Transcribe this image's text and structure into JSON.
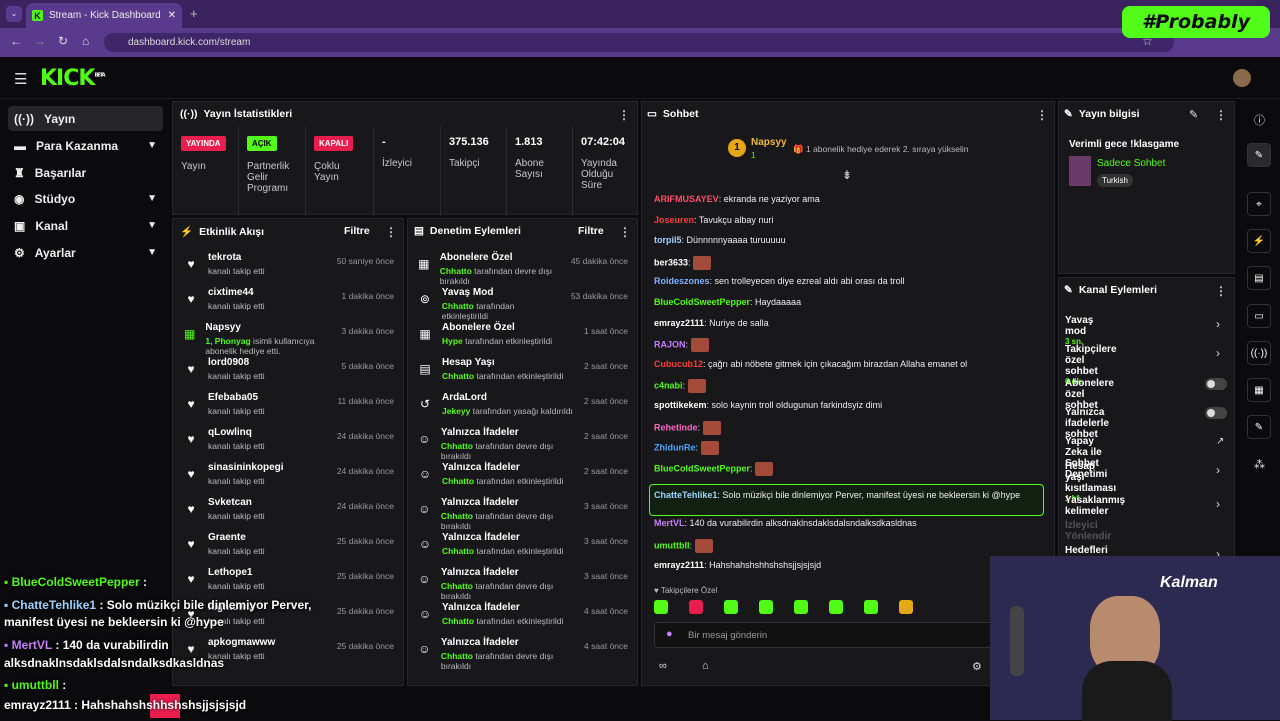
{
  "browser": {
    "tab_title": "Stream - Kick Dashboard",
    "url": "dashboard.kick.com/stream",
    "overlay_text": "#Probably"
  },
  "kick": {
    "logo": "KICK",
    "logo_sup": "BETA"
  },
  "sidebar": {
    "items": [
      {
        "label": "Yayın",
        "icon": "broadcast-icon"
      },
      {
        "label": "Para Kazanma",
        "icon": "money-icon"
      },
      {
        "label": "Başarılar",
        "icon": "trophy-icon"
      },
      {
        "label": "Stüdyo",
        "icon": "studio-icon"
      },
      {
        "label": "Kanal",
        "icon": "channel-icon"
      },
      {
        "label": "Ayarlar",
        "icon": "gear-icon"
      }
    ]
  },
  "stats": {
    "title": "Yayın İstatistikleri",
    "cells": [
      {
        "badge": "YAYINDA",
        "label": "Yayın"
      },
      {
        "badge": "AÇIK",
        "label": "Partnerlik Gelir Programı"
      },
      {
        "badge": "KAPALI",
        "label": "Çoklu Yayın"
      },
      {
        "value": "-",
        "label": "İzleyici"
      },
      {
        "value": "375.136",
        "label": "Takipçi"
      },
      {
        "value": "1.813",
        "label": "Abone Sayısı"
      },
      {
        "value": "07:42:04",
        "label": "Yayında Olduğu Süre"
      }
    ]
  },
  "activity": {
    "title": "Etkinlik Akışı",
    "filter": "Filtre",
    "items": [
      {
        "name": "tekrota",
        "sub": "kanalı takip etti",
        "time": "50 saniye önce"
      },
      {
        "name": "cixtime44",
        "sub": "kanalı takip etti",
        "time": "1 dakika önce"
      },
      {
        "name": "Napsyy",
        "sub_b": "1, Phonyag",
        "sub": " isimli kullanıcıya abonelik hediye etti.",
        "time": "3 dakika önce"
      },
      {
        "name": "lord0908",
        "sub": "kanalı takip etti",
        "time": "5 dakika önce"
      },
      {
        "name": "Efebaba05",
        "sub": "kanalı takip etti",
        "time": "11 dakika önce"
      },
      {
        "name": "qLowlinq",
        "sub": "kanalı takip etti",
        "time": "24 dakika önce"
      },
      {
        "name": "sinasininkopegi",
        "sub": "kanalı takip etti",
        "time": "24 dakika önce"
      },
      {
        "name": "Svketcan",
        "sub": "kanalı takip etti",
        "time": "24 dakika önce"
      },
      {
        "name": "Graente",
        "sub": "kanalı takip etti",
        "time": "25 dakika önce"
      },
      {
        "name": "Lethope1",
        "sub": "kanalı takip etti",
        "time": "25 dakika önce"
      },
      {
        "name": "nightowiz",
        "sub": "kanalı takip etti",
        "time": "25 dakika önce"
      },
      {
        "name": "apkogmawww",
        "sub": "kanalı takip etti",
        "time": "25 dakika önce"
      }
    ]
  },
  "moderation": {
    "title": "Denetim Eylemleri",
    "filter": "Filtre",
    "items": [
      {
        "name": "Abonelere Özel",
        "who": "Chhatto",
        "sub": " tarafından devre dışı bırakıldı",
        "time": "45 dakika önce"
      },
      {
        "name": "Yavaş Mod",
        "who": "Chhatto",
        "sub": " tarafından etkinleştirildi",
        "time": "53 dakika önce"
      },
      {
        "name": "Abonelere Özel",
        "who": "Hype",
        "sub": " tarafından etkinleştirildi",
        "time": "1 saat önce"
      },
      {
        "name": "Hesap Yaşı",
        "who": "Chhatto",
        "sub": " tarafından etkinleştirildi",
        "time": "2 saat önce"
      },
      {
        "name": "ArdaLord",
        "who": "Jekeyy",
        "sub": " tarafından yasağı kaldırıldı",
        "time": "2 saat önce"
      },
      {
        "name": "Yalnızca İfadeler",
        "who": "Chhatto",
        "sub": " tarafından devre dışı bırakıldı",
        "time": "2 saat önce"
      },
      {
        "name": "Yalnızca İfadeler",
        "who": "Chhatto",
        "sub": " tarafından etkinleştirildi",
        "time": "2 saat önce"
      },
      {
        "name": "Yalnızca İfadeler",
        "who": "Chhatto",
        "sub": " tarafından devre dışı bırakıldı",
        "time": "3 saat önce"
      },
      {
        "name": "Yalnızca İfadeler",
        "who": "Chhatto",
        "sub": " tarafından etkinleştirildi",
        "time": "3 saat önce"
      },
      {
        "name": "Yalnızca İfadeler",
        "who": "Chhatto",
        "sub": " tarafından devre dışı bırakıldı",
        "time": "3 saat önce"
      },
      {
        "name": "Yalnızca İfadeler",
        "who": "Chhatto",
        "sub": " tarafından etkinleştirildi",
        "time": "4 saat önce"
      },
      {
        "name": "Yalnızca İfadeler",
        "who": "Chhatto",
        "sub": " tarafından devre dışı bırakıldı",
        "time": "4 saat önce"
      }
    ]
  },
  "chat": {
    "title": "Sohbet",
    "pinned_user": "Napsyy",
    "pinned_count": "1",
    "pinned_rank": "1",
    "pinned_text": "1 abonelik hediye ederek 2. sıraya yükselin",
    "messages": [
      {
        "user": "ARIFMUSAYEV",
        "color": "#ff4d6d",
        "text": ": ekranda ne yaziyor ama"
      },
      {
        "user": "Joseuren",
        "color": "#ff3b3b",
        "text": ": Tavukçu albay nuri"
      },
      {
        "user": "torpil5",
        "color": "#9fd3ff",
        "text": ": Dünnnnnyaaaa turuuuuu"
      },
      {
        "user": "ber3633",
        "color": "#ffffff",
        "text": ":",
        "emote": true
      },
      {
        "user": "Roideszones",
        "color": "#7fb3ff",
        "text": ": sen trolleyecen diye ezreal aldı abi orası da troll"
      },
      {
        "user": "BlueColdSweetPepper",
        "color": "#53fc18",
        "text": ": Haydaaaaa"
      },
      {
        "user": "emrayz2111",
        "color": "#ffffff",
        "text": ": Nuriye de salla"
      },
      {
        "user": "RAJON",
        "color": "#c77dff",
        "text": ":",
        "emote": true
      },
      {
        "user": "Cubucub12",
        "color": "#ff3b3b",
        "text": ": çağrı abi nöbete gitmek için çıkacağım birazdan Allaha emanet ol"
      },
      {
        "user": "c4nabi",
        "color": "#53fc18",
        "text": ":",
        "emote": true
      },
      {
        "user": "spottikekem",
        "color": "#ffffff",
        "text": ": solo kaynin troll oldugunun farkindsyiz dimi"
      },
      {
        "user": "Rehetinde",
        "color": "#ff66c4",
        "text": ":",
        "emote": true
      },
      {
        "user": "ZhidunRe",
        "color": "#4da3ff",
        "text": ":",
        "emote": true
      },
      {
        "user": "BlueColdSweetPepper",
        "color": "#53fc18",
        "text": ":",
        "emote": true
      },
      {
        "user": "ChatteTehlike1",
        "color": "#9fd3ff",
        "text": ": Solo müzikçi bile dinlemiyor Perver, manifest üyesi ne bekleersin ki @hype",
        "highlight": true
      },
      {
        "user": "MertVL",
        "color": "#c77dff",
        "text": ": 140 da vurabilirdin alksdnaklnsdaklsdalsndalksdkasldnas"
      },
      {
        "user": "umuttbll",
        "color": "#53fc18",
        "text": ":",
        "emote": true
      },
      {
        "user": "emrayz2111",
        "color": "#ffffff",
        "text": ": Hahshahshshhshshsjjsjsjsjd"
      }
    ],
    "follower_only": "Takipçilere Özel",
    "input_placeholder": "Bir mesaj gönderin"
  },
  "stream_info": {
    "title": "Yayın bilgisi",
    "stream_title": "Verimli gece !klasgame",
    "category": "Sadece Sohbet",
    "language": "Turkish"
  },
  "channel_actions": {
    "title": "Kanal Eylemleri",
    "items": [
      {
        "label": "Yavaş mod",
        "sub": "3 sn.",
        "kind": "chevron"
      },
      {
        "label": "Takipçilere özel sohbet",
        "sub": "6 dk.",
        "kind": "chevron"
      },
      {
        "label": "Abonelere özel sohbet",
        "kind": "toggle"
      },
      {
        "label": "Yalnızca ifadelerle sohbet",
        "kind": "toggle"
      },
      {
        "label": "Yapay Zeka ile Sohbet Denetimi",
        "kind": "external"
      },
      {
        "label": "Hesap yaşı kısıtlaması",
        "sub": "1 hf.",
        "kind": "chevron"
      },
      {
        "label": "Yasaklanmış kelimeler",
        "kind": "chevron"
      },
      {
        "label": "İzleyici Yönlendir",
        "kind": "disabled"
      },
      {
        "label": "Hedefleri belirleyin",
        "kind": "chevron"
      }
    ]
  },
  "overlay_chat": [
    {
      "user": "BlueColdSweetPepper",
      "color": "#53fc18",
      "text": " :"
    },
    {
      "user": "ChatteTehlike1",
      "color": "#9fd3ff",
      "text": " : Solo müzikçi bile dinlemiyor Perver,"
    },
    {
      "user": "",
      "color": "#fff",
      "text": "manifest üyesi ne bekleersin ki @hype"
    },
    {
      "user": "MertVL",
      "color": "#c77dff",
      "text": " : 140 da vurabilirdin"
    },
    {
      "user": "",
      "color": "#fff",
      "text": "alksdnaklnsdaklsdalsndalksdkasldnas"
    },
    {
      "user": "umuttbll",
      "color": "#53fc18",
      "text": " :"
    },
    {
      "user": "emrayz2111",
      "color": "#fff",
      "text": " : Hahshahshshhshshsjjsjsjsjd"
    }
  ],
  "webcam_text": "Kalman",
  "colors": {
    "brand": "#53fc18",
    "live": "#e91e4f",
    "bg": "#0b0b0d",
    "panel": "#18181b"
  }
}
